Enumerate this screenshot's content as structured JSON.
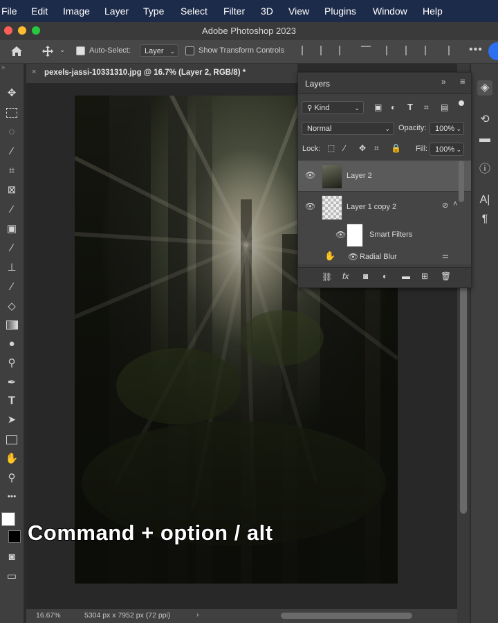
{
  "menubar": {
    "items": [
      "File",
      "Edit",
      "Image",
      "Layer",
      "Type",
      "Select",
      "Filter",
      "3D",
      "View",
      "Plugins",
      "Window",
      "Help"
    ]
  },
  "window": {
    "title": "Adobe Photoshop 2023"
  },
  "options": {
    "auto_select_label": "Auto-Select:",
    "auto_select_value": "Layer",
    "show_transform_label": "Show Transform Controls"
  },
  "document": {
    "tab_title": "pexels-jassi-10331310.jpg @ 16.7% (Layer 2, RGB/8) *",
    "zoom": "16.67%",
    "dimensions": "5304 px x 7952 px (72 ppi)"
  },
  "layers_panel": {
    "title": "Layers",
    "filter": "Kind",
    "blend_mode": "Normal",
    "opacity_label": "Opacity:",
    "opacity_value": "100%",
    "lock_label": "Lock:",
    "fill_label": "Fill:",
    "fill_value": "100%",
    "layers": [
      {
        "name": "Layer 2"
      },
      {
        "name": "Layer 1 copy 2"
      },
      {
        "name": "Smart Filters"
      },
      {
        "name": "Radial Blur"
      }
    ]
  },
  "overlay": {
    "caption_main": "Command + option / alt"
  },
  "colors": {
    "menubar": "#1d2b4a",
    "panel": "#3f3f3f",
    "accent": "#2d6ff1"
  }
}
